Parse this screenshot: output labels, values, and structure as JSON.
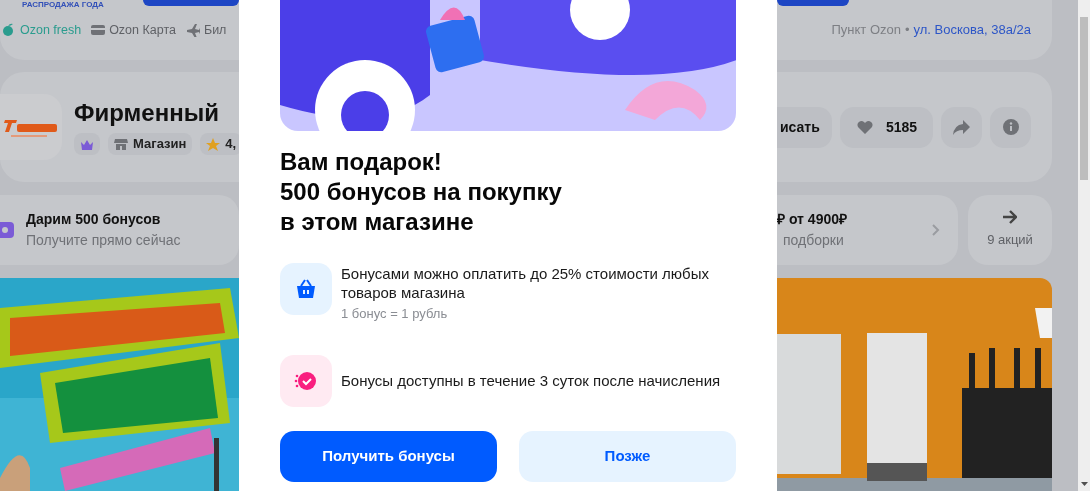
{
  "background_page": {
    "promo_label": "РАСПРОДАЖА ГОДА",
    "nav_links": [
      {
        "label": "Ozon fresh",
        "kind": "fresh"
      },
      {
        "label": "Ozon Карта",
        "kind": "card"
      },
      {
        "label": "Бил",
        "kind": "plane"
      }
    ],
    "pickup": {
      "label": "Пункт Ozon",
      "separator": "•",
      "address": "ул. Воскова, 38а/2а"
    },
    "store": {
      "name": "Фирменный",
      "badges": [
        {
          "kind": "crown"
        },
        {
          "kind": "shop",
          "label": "Магазин"
        },
        {
          "kind": "rating",
          "label": "4,"
        }
      ],
      "actions": [
        {
          "kind": "subscribe",
          "label": "исать"
        },
        {
          "kind": "favorite",
          "label": "5185"
        },
        {
          "kind": "share"
        },
        {
          "kind": "info"
        }
      ]
    },
    "offers": [
      {
        "kind": "bonus",
        "title": "Дарим 500 бонусов",
        "subtitle": "Получите прямо сейчас"
      },
      {
        "kind": "collection",
        "title": "₽ от 4900₽",
        "subtitle": "подборки"
      },
      {
        "kind": "all",
        "subtitle": "9 акций"
      }
    ]
  },
  "dialog": {
    "title": "Вам подарок!\n500 бонусов на покупку\nв этом магазине",
    "features": [
      {
        "kind": "basket",
        "text": "Бонусами можно оплатить до 25% стоимости любых товаров магазина",
        "note": "1 бонус = 1 рубль"
      },
      {
        "kind": "timer",
        "text": "Бонусы доступны в течение 3 суток после начисления"
      }
    ],
    "buttons": [
      {
        "label": "Получить бонусы",
        "kind": "primary"
      },
      {
        "label": "Позже",
        "kind": "secondary"
      }
    ]
  }
}
